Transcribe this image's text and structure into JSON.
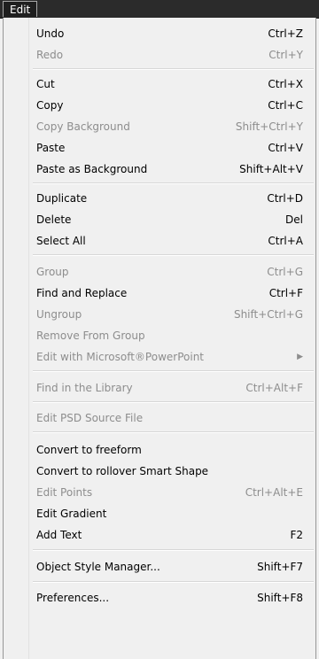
{
  "menubar": {
    "active_menu": "Edit"
  },
  "menu": {
    "items": [
      {
        "label": "Undo",
        "shortcut": "Ctrl+Z",
        "enabled": true
      },
      {
        "label": "Redo",
        "shortcut": "Ctrl+Y",
        "enabled": false
      },
      {
        "label": "Cut",
        "shortcut": "Ctrl+X",
        "enabled": true
      },
      {
        "label": "Copy",
        "shortcut": "Ctrl+C",
        "enabled": true
      },
      {
        "label": "Copy Background",
        "shortcut": "Shift+Ctrl+Y",
        "enabled": false
      },
      {
        "label": "Paste",
        "shortcut": "Ctrl+V",
        "enabled": true
      },
      {
        "label": "Paste as Background",
        "shortcut": "Shift+Alt+V",
        "enabled": true
      },
      {
        "label": "Duplicate",
        "shortcut": "Ctrl+D",
        "enabled": true
      },
      {
        "label": "Delete",
        "shortcut": "Del",
        "enabled": true
      },
      {
        "label": "Select All",
        "shortcut": "Ctrl+A",
        "enabled": true
      },
      {
        "label": "Group",
        "shortcut": "Ctrl+G",
        "enabled": false
      },
      {
        "label": "Find and Replace",
        "shortcut": "Ctrl+F",
        "enabled": true
      },
      {
        "label": "Ungroup",
        "shortcut": "Shift+Ctrl+G",
        "enabled": false
      },
      {
        "label": "Remove From Group",
        "shortcut": "",
        "enabled": false
      },
      {
        "label": "Edit with Microsoft®PowerPoint",
        "shortcut": "",
        "enabled": false,
        "submenu_icon": "chevron-right-icon"
      },
      {
        "label": "Find in the Library",
        "shortcut": "Ctrl+Alt+F",
        "enabled": false
      },
      {
        "label": "Edit PSD Source File",
        "shortcut": "",
        "enabled": false
      },
      {
        "label": "Convert to freeform",
        "shortcut": "",
        "enabled": true
      },
      {
        "label": "Convert to rollover Smart Shape",
        "shortcut": "",
        "enabled": true
      },
      {
        "label": "Edit Points",
        "shortcut": "Ctrl+Alt+E",
        "enabled": false
      },
      {
        "label": "Edit Gradient",
        "shortcut": "",
        "enabled": true
      },
      {
        "label": "Add Text",
        "shortcut": "F2",
        "enabled": true
      },
      {
        "label": "Object Style Manager...",
        "shortcut": "Shift+F7",
        "enabled": true
      },
      {
        "label": "Preferences...",
        "shortcut": "Shift+F8",
        "enabled": true
      }
    ]
  },
  "colors": {
    "menu_background": "#f0f0f0",
    "enabled_text": "#000000",
    "disabled_text": "#8d8d8d",
    "menubar_background": "#2b2b2b"
  }
}
